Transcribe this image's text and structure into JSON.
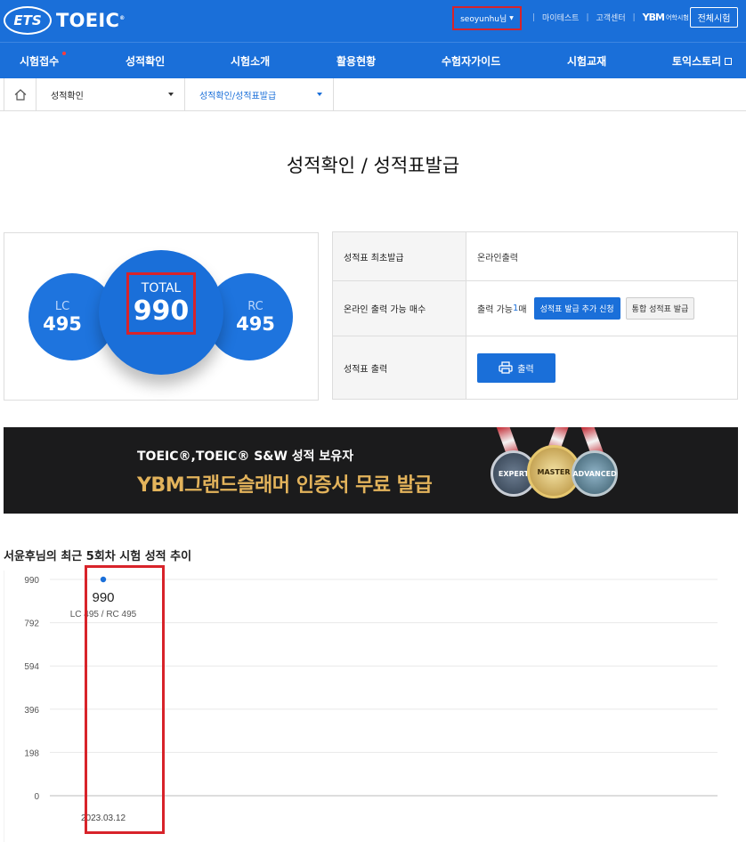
{
  "header": {
    "logo_ets": "ETS",
    "logo_toeic": "TOEIC",
    "user": "seoyunhu님",
    "links": [
      "마이테스트",
      "고객센터"
    ],
    "ybm_logo": "YBM",
    "ybm_sub": "어학시험",
    "full_exam": "전체시험"
  },
  "nav": {
    "items": [
      "시험접수",
      "성적확인",
      "시험소개",
      "활용현황",
      "수험자가이드",
      "시험교재",
      "토익스토리"
    ]
  },
  "breadcrumb": {
    "level1": "성적확인",
    "level2": "성적확인/성적표발급"
  },
  "page_title": "성적확인 / 성적표발급",
  "scores": {
    "lc_label": "LC",
    "lc_value": "495",
    "total_label": "TOTAL",
    "total_value": "990",
    "rc_label": "RC",
    "rc_value": "495"
  },
  "info": {
    "row1_key": "성적표 최초발급",
    "row1_val": "온라인출력",
    "row2_key": "온라인 출력 가능 매수",
    "row2_prefix": "출력 가능 ",
    "row2_count": "1",
    "row2_suffix": "매",
    "add_button": "성적표 발급 추가 신청",
    "combined_button": "통합 성적표 발급",
    "row3_key": "성적표 출력",
    "print_button": "출력"
  },
  "banner": {
    "sub": "TOEIC®,TOEIC® S&W 성적 보유자",
    "main": "YBM그랜드슬래머 인증서 무료 발급",
    "medals": [
      "EXPERT",
      "MASTER",
      "ADVANCED"
    ]
  },
  "chart_title": "서윤후님의 최근 5회차 시험 성적 추이",
  "chart_data": {
    "type": "line",
    "yticks": [
      990,
      792,
      594,
      396,
      198,
      0
    ],
    "ylim": [
      0,
      990
    ],
    "grid": true,
    "categories": [
      "2023.03.12"
    ],
    "series": [
      {
        "values": [
          990
        ],
        "labels": [
          "LC 495 / RC 495"
        ]
      }
    ],
    "color": "#1a6fd9"
  }
}
